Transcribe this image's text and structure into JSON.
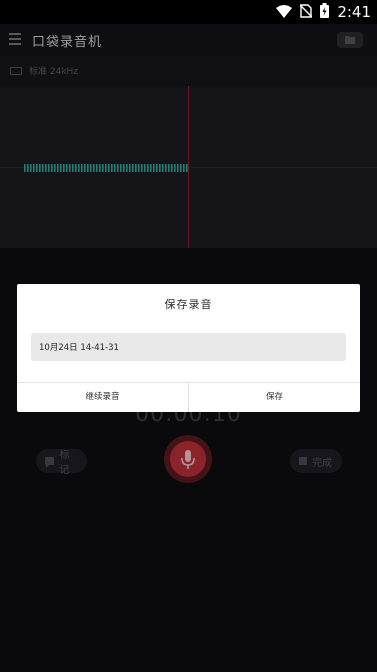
{
  "status_bar": {
    "time": "2:41"
  },
  "app_bar": {
    "title": "口袋录音机"
  },
  "quality": {
    "label": "标准 24kHz"
  },
  "timer": {
    "value": "00:00:10"
  },
  "controls": {
    "mark_label": "标记",
    "done_label": "完成"
  },
  "dialog": {
    "title": "保存录音",
    "filename_value": "10月24日 14-41-31",
    "continue_label": "继续录音",
    "save_label": "保存"
  },
  "colors": {
    "accent_red": "#b83038",
    "waveform": "#2fa89a",
    "background": "#0d0d10"
  }
}
